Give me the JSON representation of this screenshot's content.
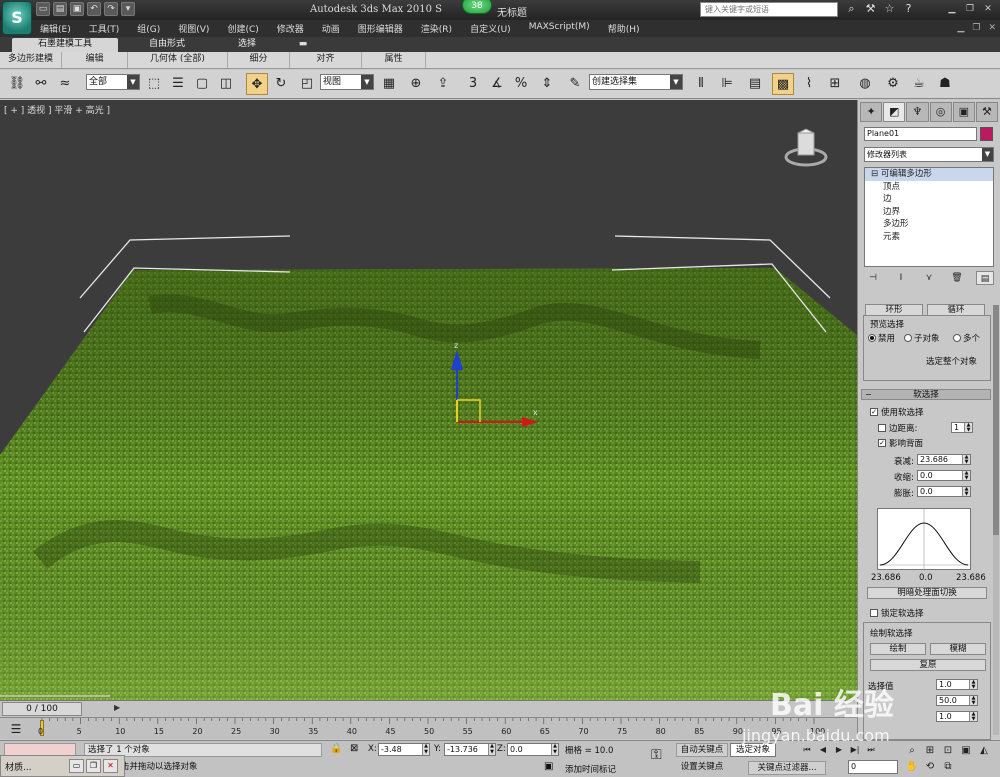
{
  "title_bar": {
    "app_title": "Autodesk 3ds Max  2010 S",
    "file_name": "无标题",
    "badge": "38",
    "search_placeholder": "键入关键字或短语",
    "logo": "app-logo-icon",
    "quick_access_icons": [
      "new-file-icon",
      "open-folder-icon",
      "save-icon",
      "undo-icon",
      "redo-icon",
      "dropdown-icon"
    ],
    "right_icons": [
      "binoculars-icon",
      "wrench-icon",
      "star-icon",
      "help-icon"
    ],
    "window_controls": [
      "minimize-icon",
      "restore-icon",
      "close-icon"
    ]
  },
  "menu": {
    "items": [
      "编辑(E)",
      "工具(T)",
      "组(G)",
      "视图(V)",
      "创建(C)",
      "修改器",
      "动画",
      "图形编辑器",
      "渲染(R)",
      "自定义(U)",
      "MAXScript(M)",
      "帮助(H)"
    ]
  },
  "ribbon": {
    "tabs": [
      "石墨建模工具",
      "自由形式",
      "选择"
    ],
    "panels": [
      "多边形建模",
      "编辑",
      "几何体 (全部)",
      "细分",
      "对齐",
      "属性"
    ]
  },
  "toolbar": {
    "filter_value": "全部",
    "coord_system": "视图",
    "named_selection": "创建选择集",
    "snap_label": "3"
  },
  "viewport": {
    "label": "[ + ] 透视 ] 平滑 + 高光 ]",
    "axis_z": "z",
    "axis_x": "x",
    "colors": {
      "background": "#3c3c3c",
      "grass": "#5a8a22"
    }
  },
  "command_panel": {
    "object_name": "Plane01",
    "object_color": "#c01860",
    "modifier_list": "修改器列表",
    "stack": {
      "top": "可编辑多边形",
      "children": [
        "顶点",
        "边",
        "边界",
        "多边形",
        "元素"
      ]
    },
    "ring_label": "环形",
    "loop_label": "循环",
    "preview_selection": {
      "title": "预览选择",
      "options": [
        "禁用",
        "子对象",
        "多个"
      ],
      "selected": "禁用",
      "select_all": "选定整个对象"
    },
    "soft_selection": {
      "title": "软选择",
      "use_soft": "使用软选择",
      "edge_distance": "边距离:",
      "edge_distance_value": "1",
      "affect_backfacing": "影响背面",
      "falloff_label": "衰减:",
      "falloff_value": "23.686",
      "pinch_label": "收缩:",
      "pinch_value": "0.0",
      "bubble_label": "膨胀:",
      "bubble_value": "0.0",
      "curve_left": "23.686",
      "curve_mid": "0.0",
      "curve_right": "23.686",
      "shaded_face_toggle": "明暗处理面切换",
      "lock_soft": "锁定软选择"
    },
    "paint_soft": {
      "title": "绘制软选择",
      "paint": "绘制",
      "blur": "模糊",
      "revert": "复原",
      "select_value_label": "选择值",
      "select_value": "1.0",
      "brush_size_value": "50.0",
      "brush_strength_value": "1.0"
    }
  },
  "time": {
    "frame_display": "0 / 100",
    "ticks": [
      "0",
      "5",
      "10",
      "15",
      "20",
      "25",
      "30",
      "35",
      "40",
      "45",
      "50",
      "55",
      "60",
      "65",
      "70",
      "75",
      "80",
      "85",
      "90",
      "95",
      "100"
    ]
  },
  "status": {
    "selected": "选择了 1 个对象",
    "prompt": "单击或单击并拖动以选择对象",
    "x_label": "X:",
    "x_value": "-3.48",
    "y_label": "Y:",
    "y_value": "-13.736",
    "z_label": "Z:",
    "z_value": "0.0",
    "grid": "栅格 = 10.0",
    "add_time_tag": "添加时间标记",
    "auto_key": "自动关键点",
    "set_key": "设置关键点",
    "selected_set": "选定对象",
    "key_filters": "关键点过滤器...",
    "frame_value": "0"
  },
  "taskbar": {
    "label": "材质..."
  },
  "watermark": {
    "main": "Bai 经验",
    "sub": "jingyan.baidu.com"
  }
}
